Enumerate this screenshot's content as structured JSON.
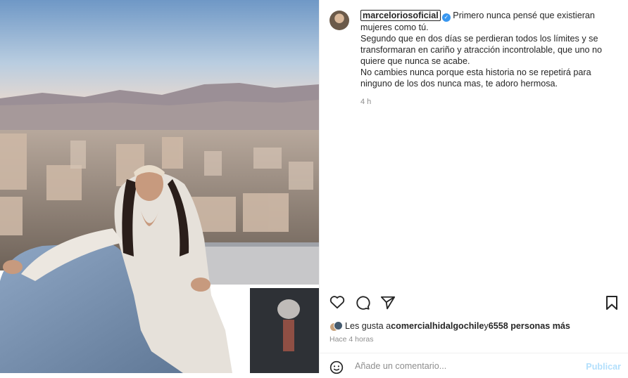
{
  "post": {
    "username": "marceloriosoficial",
    "caption_lines": [
      "Primero nunca pensé que existieran mujeres como tú.",
      "Segundo que en dos días se perdieran todos los límites y se transformaran en cariño y atracción incontrolable, que uno no quiere que nunca se acabe.",
      "No cambies nunca porque esta historia no se repetirá para ninguno de los dos nunca mas, te adoro hermosa."
    ],
    "caption_time": "4 h",
    "likes_prefix": "Les gusta a ",
    "likes_user": "comercialhidalgochile",
    "likes_mid": " y ",
    "likes_count": "6558 personas más",
    "posted_ago": "Hace 4 horas",
    "comment_placeholder": "Añade un comentario...",
    "publish_label": "Publicar"
  },
  "icons": {
    "verified": "verified-badge-icon",
    "like": "heart-icon",
    "comment": "comment-icon",
    "share": "share-icon",
    "save": "bookmark-icon",
    "emoji": "emoji-icon"
  },
  "colors": {
    "verified": "#3897f0",
    "publish": "#b2dffc",
    "muted": "#8e8e8e"
  }
}
